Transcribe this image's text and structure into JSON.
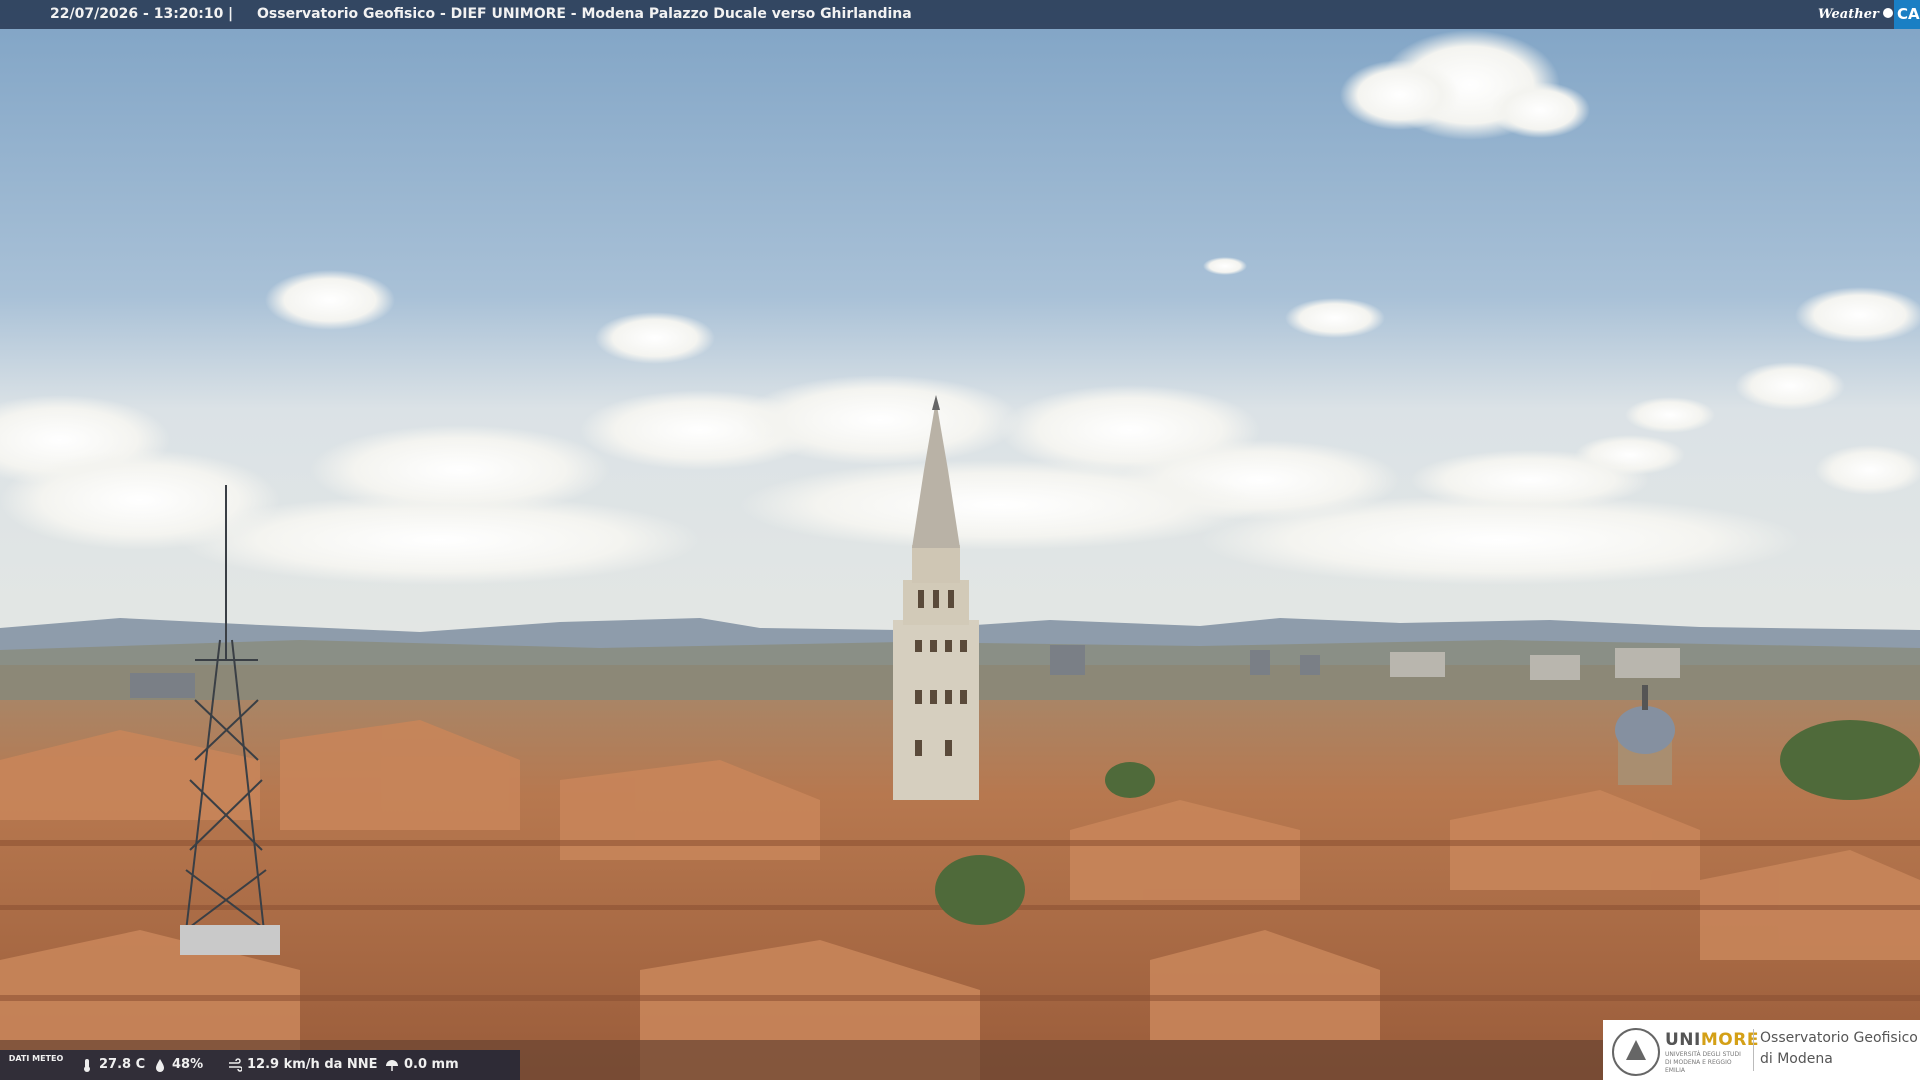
{
  "header": {
    "timestamp": "22/07/2026 - 13:20:10",
    "separator": "|",
    "title": "Osservatorio Geofisico - DIEF UNIMORE - Modena Palazzo Ducale verso Ghirlandina"
  },
  "brand": {
    "weather": "Weather",
    "cam": "CAM"
  },
  "weather": {
    "label": "DATI METEO",
    "temperature": "27.8 C",
    "humidity": "48%",
    "wind": "12.9 km/h da NNE",
    "rain": "0.0 mm",
    "icons": [
      "thermometer-icon",
      "humidity-drop-icon",
      "wind-icon",
      "rain-gauge-icon"
    ]
  },
  "logo": {
    "name_part1": "UNI",
    "name_part2": "MORE",
    "subtitle": "UNIVERSITÀ DEGLI STUDI DI MODENA E REGGIO EMILIA",
    "obs_line1": "Osservatorio Geofisico",
    "obs_line2": "di Modena"
  },
  "colors": {
    "sky_top": "#86a9c9",
    "sky_horizon": "#dfe4e4",
    "roofs": "#b77a52",
    "tower": "#d9d2c4",
    "accent": "#1a7fc4"
  }
}
